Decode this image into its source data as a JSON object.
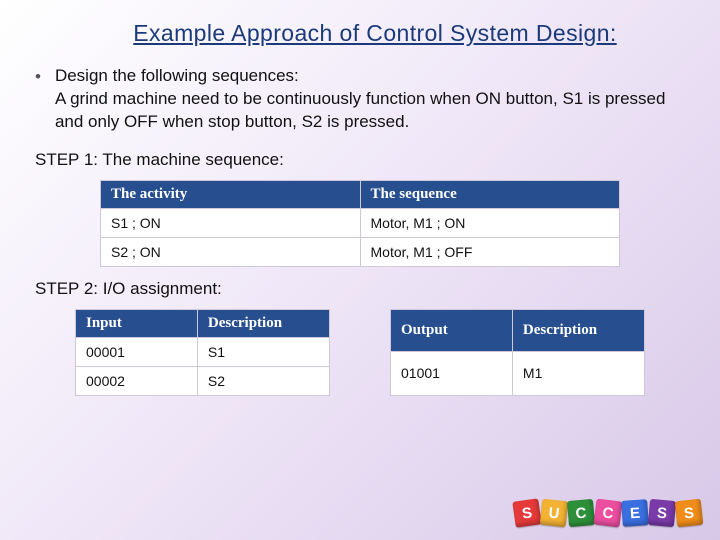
{
  "title": "Example Approach of Control System Design:",
  "bullets": [
    {
      "lead": "Design the following sequences:",
      "rest": "A grind machine need to be continuously function when ON button, S1 is pressed and only OFF when stop button, S2 is pressed."
    }
  ],
  "step1_label": "STEP 1: The machine sequence:",
  "table_seq": {
    "headers": [
      "The activity",
      "The sequence"
    ],
    "rows": [
      [
        "S1 ; ON",
        "Motor, M1 ; ON"
      ],
      [
        "S2 ; ON",
        "Motor, M1 ; OFF"
      ]
    ]
  },
  "step2_label": "STEP 2: I/O assignment:",
  "table_input": {
    "headers": [
      "Input",
      "Description"
    ],
    "rows": [
      [
        "00001",
        "S1"
      ],
      [
        "00002",
        "S2"
      ]
    ]
  },
  "table_output": {
    "headers": [
      "Output",
      "Description"
    ],
    "rows": [
      [
        "01001",
        "M1"
      ]
    ]
  },
  "blocks": [
    "S",
    "U",
    "C",
    "C",
    "E",
    "S",
    "S"
  ]
}
